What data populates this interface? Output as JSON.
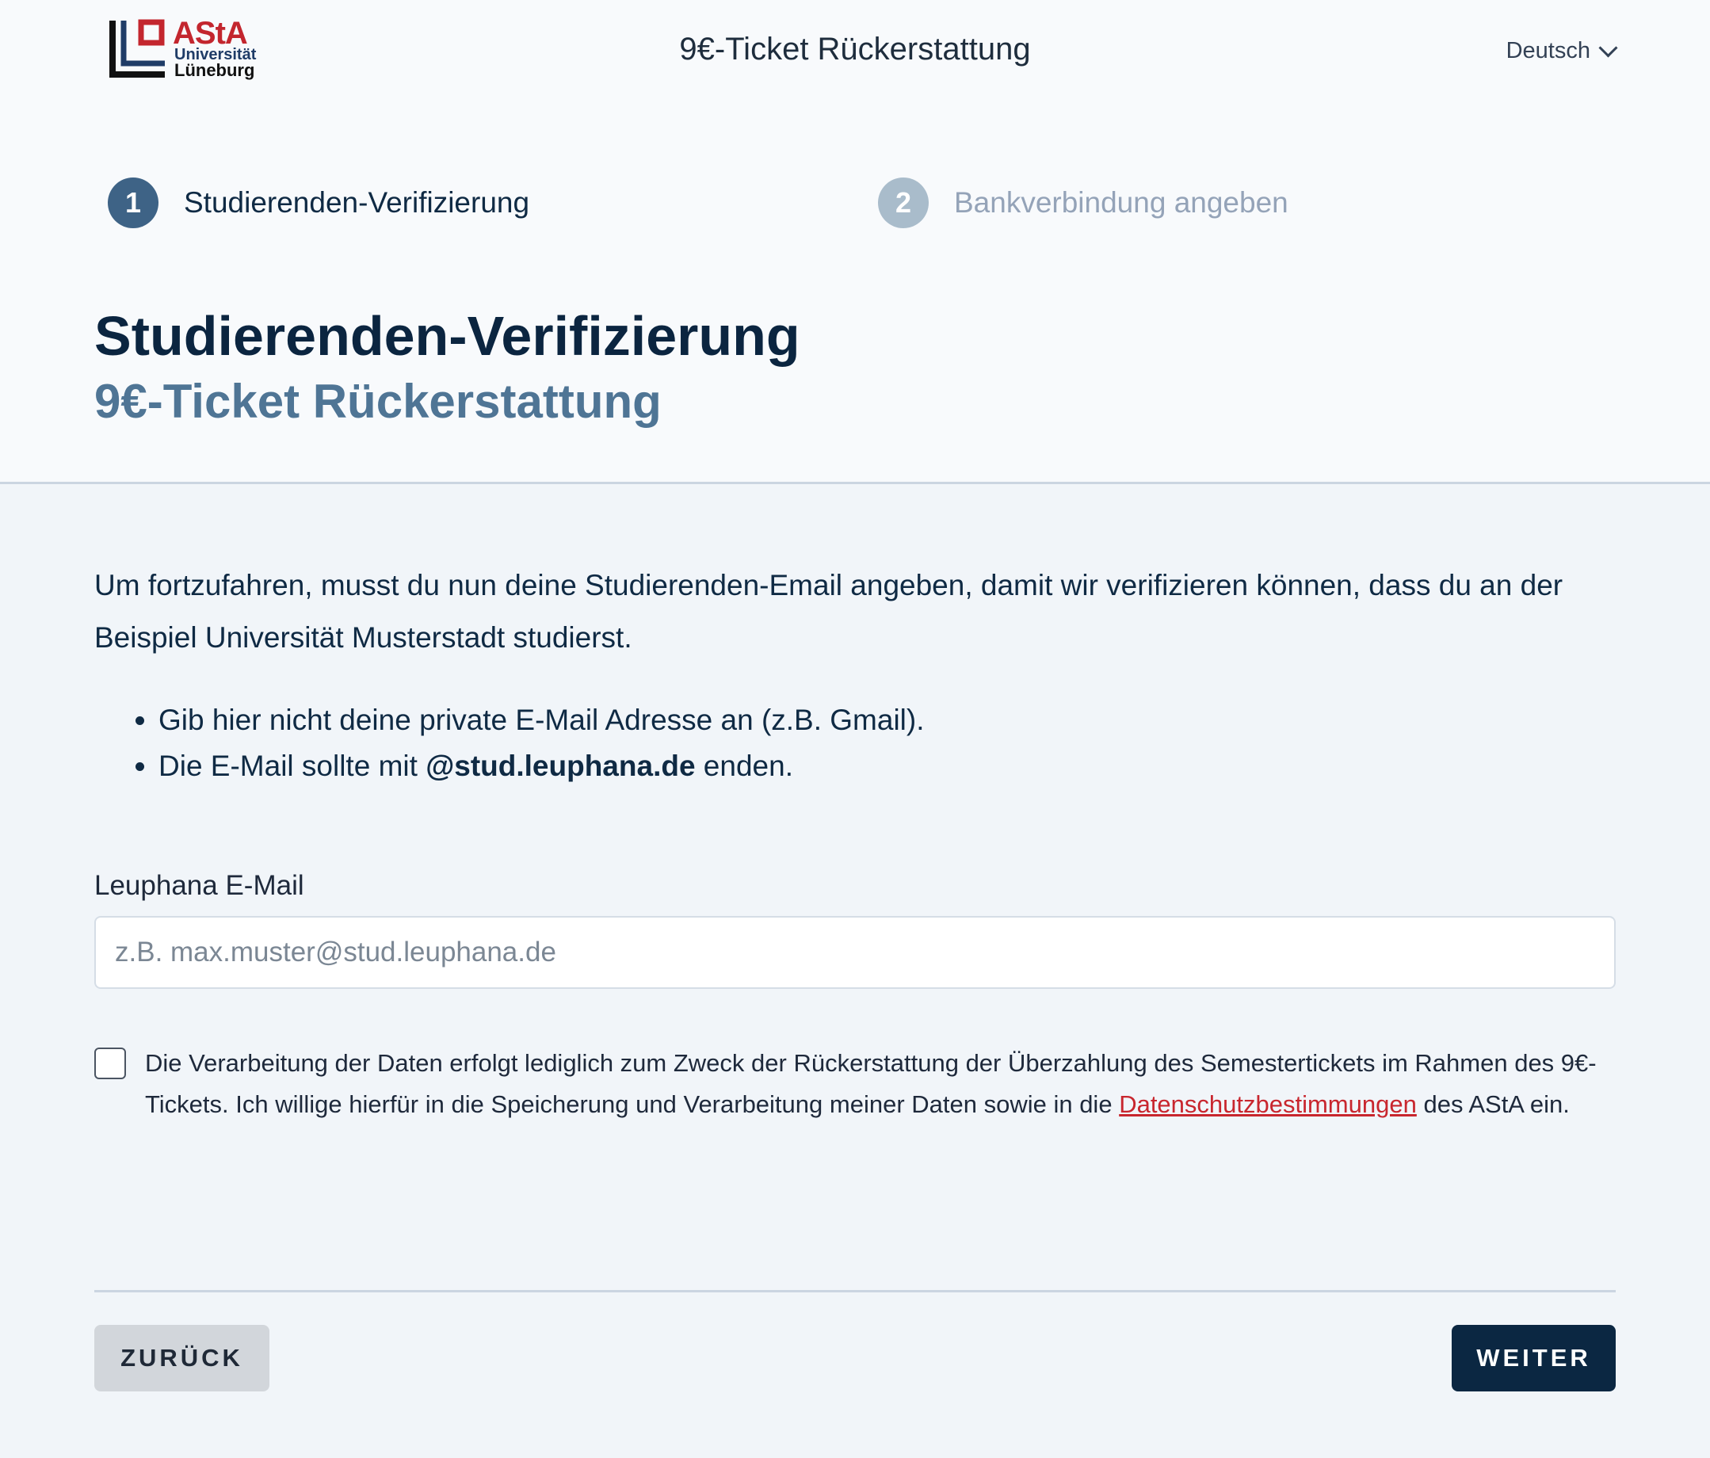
{
  "header": {
    "logo": {
      "line1": "AStA",
      "line2": "Universität",
      "line3": "Lüneburg"
    },
    "title": "9€-Ticket Rückerstattung",
    "language": "Deutsch"
  },
  "steps": [
    {
      "number": "1",
      "label": "Studierenden-Verifizierung",
      "active": true
    },
    {
      "number": "2",
      "label": "Bankverbindung angeben",
      "active": false
    }
  ],
  "page": {
    "title": "Studierenden-Verifizierung",
    "subtitle": "9€-Ticket Rückerstattung"
  },
  "intro": "Um fortzufahren, musst du nun deine Studierenden-Email angeben, damit wir verifizieren können, dass du an der Beispiel Universität Musterstadt studierst.",
  "bullets": {
    "item1": "Gib hier nicht deine private E-Mail Adresse an (z.B. Gmail).",
    "item2_prefix": "Die E-Mail sollte mit ",
    "item2_bold": "@stud.leuphana.de",
    "item2_suffix": " enden."
  },
  "email_field": {
    "label": "Leuphana E-Mail",
    "value": "",
    "placeholder": "z.B. max.muster@stud.leuphana.de"
  },
  "consent": {
    "checked": false,
    "text": "Die Verarbeitung der Daten erfolgt lediglich zum Zweck der Rückerstattung der Überzahlung des Semestertickets im Rahmen des 9€-Tickets. Ich willige hierfür in die Speicherung und Verarbeitung meiner Daten sowie in die ",
    "link_text": "Datenschutzbestimmungen",
    "suffix": " des AStA ein."
  },
  "buttons": {
    "back": "ZURÜCK",
    "next": "WEITER"
  },
  "colors": {
    "primary": "#0b2742",
    "step_active": "#3e6386",
    "step_inactive": "#a9bccb",
    "subtitle": "#4f7595",
    "link": "#c8262e",
    "logo_red": "#c3262e"
  }
}
